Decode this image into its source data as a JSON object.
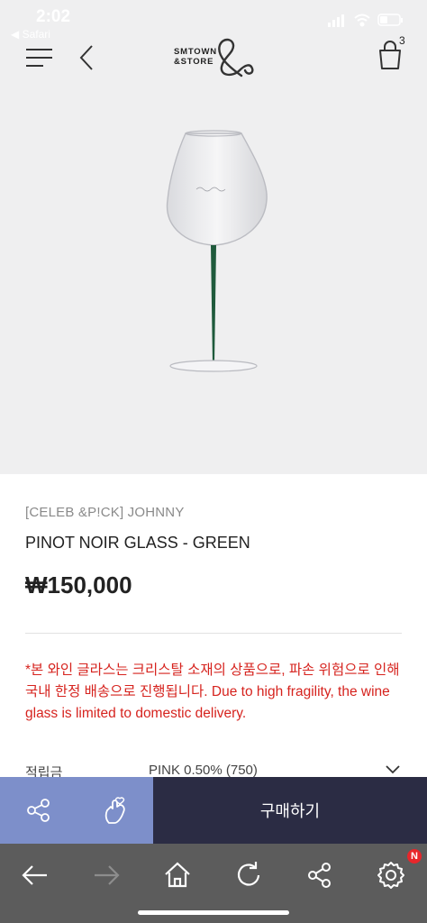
{
  "status_bar": {
    "time": "2:02",
    "back_label": "◀ Safari"
  },
  "header": {
    "logo_line1": "SMTOWN",
    "logo_line2": "&STORE",
    "cart_count": "3"
  },
  "product": {
    "brand": "[CELEB &P!CK] JOHNNY",
    "name": "PINOT NOIR GLASS - GREEN",
    "price": "₩150,000",
    "notice": "*본 와인 글라스는 크리스탈 소재의 상품으로, 파손 위험으로 인해 국내 한정 배송으로 진행됩니다. Due to high fragility, the wine glass is limited to domestic delivery.",
    "points_label": "적립금",
    "points_value": "PINK 0.50% (750)"
  },
  "actions": {
    "buy_label": "구매하기"
  },
  "toolbar": {
    "badge": "N"
  },
  "colors": {
    "accent_blue": "#7d8fca",
    "buy_dark": "#2b2c44",
    "notice_red": "#d6231e",
    "stem_green": "#1f5a3c"
  }
}
